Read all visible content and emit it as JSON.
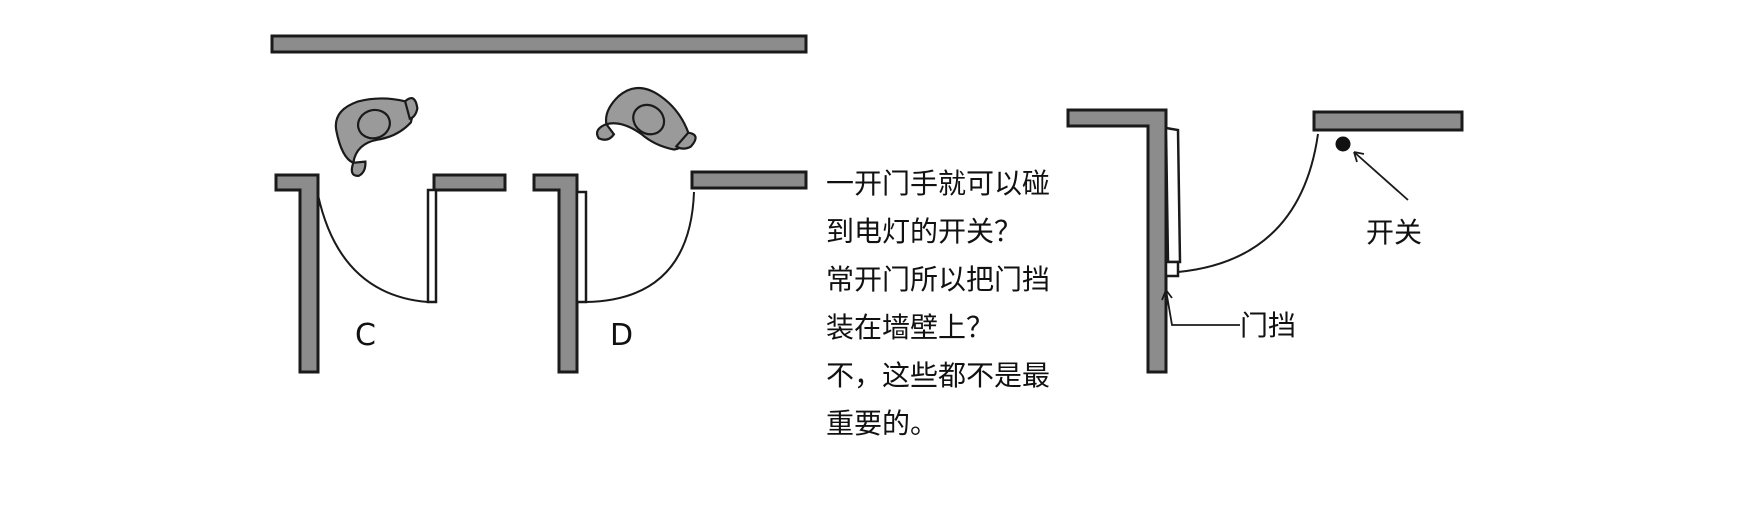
{
  "labels": {
    "door_c": "C",
    "door_d": "D",
    "switch": "开关",
    "door_stop": "门挡"
  },
  "caption": [
    "一开门手就可以碰",
    "到电灯的开关？",
    "常开门所以把门挡",
    "装在墙壁上？",
    "不，这些都不是最",
    "重要的。"
  ],
  "colors": {
    "wall": "#8c8c8c",
    "outline": "#1a1a1a",
    "background": "#ffffff"
  },
  "icons": {
    "person": "person-top-view-icon",
    "switch": "light-switch-icon"
  }
}
